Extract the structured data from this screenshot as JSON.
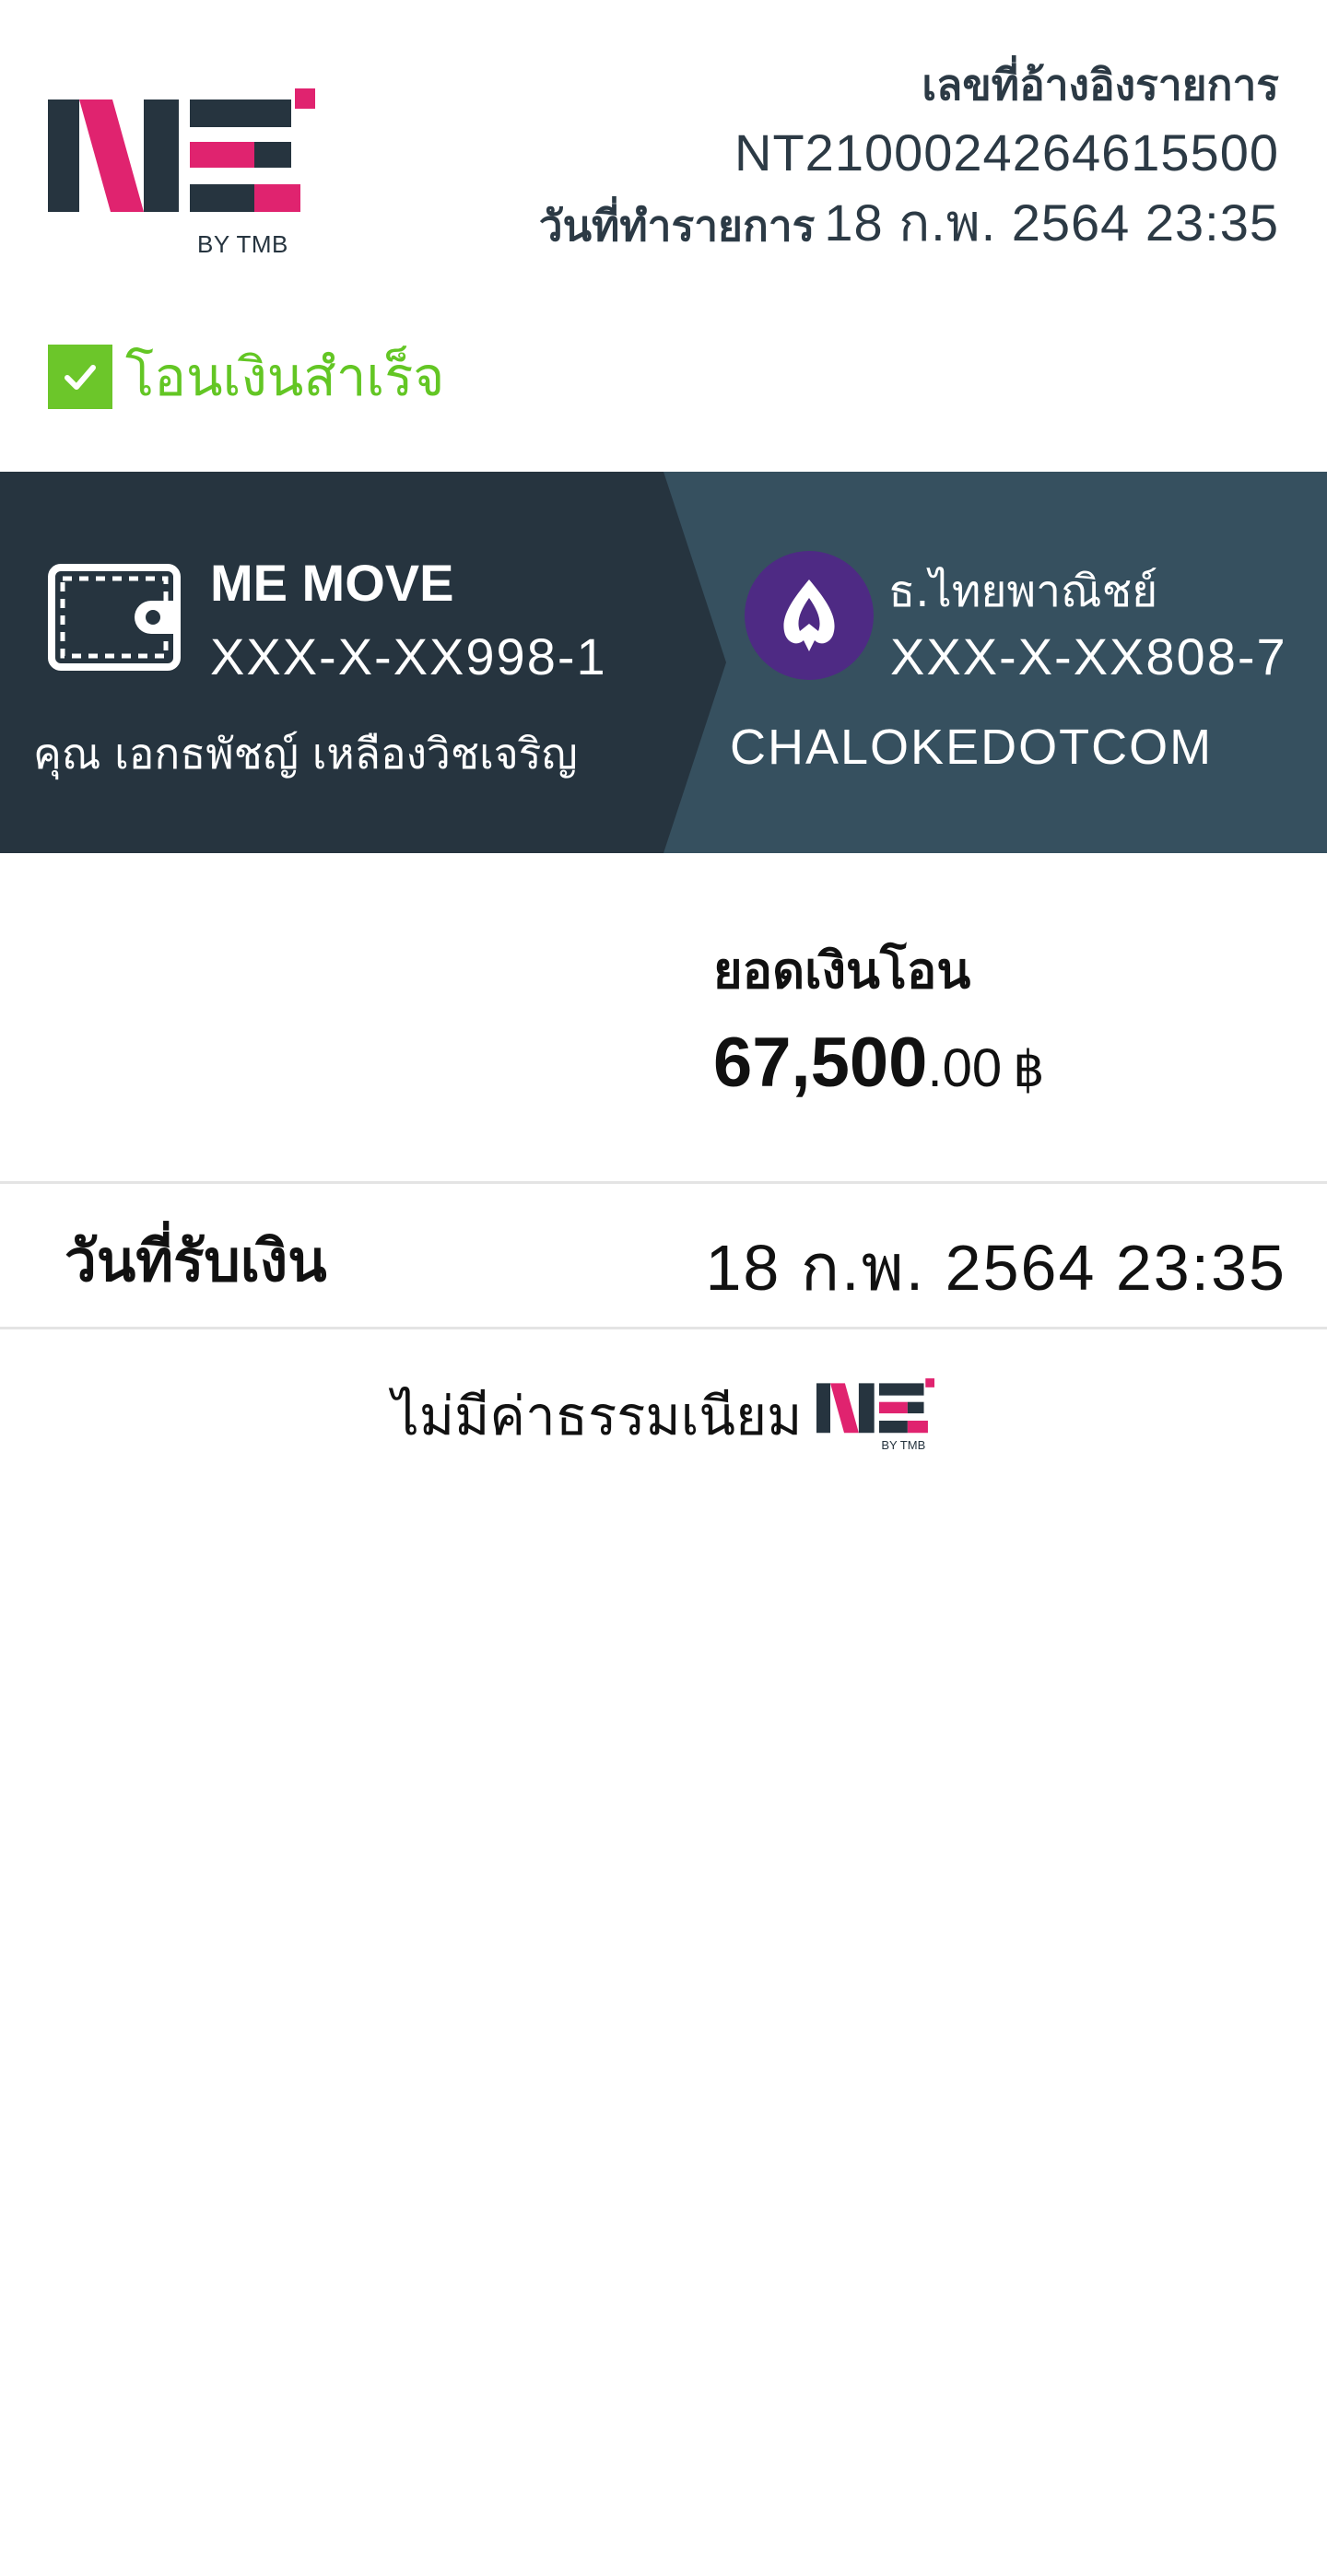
{
  "header": {
    "logo_text": "BY TMB",
    "reference_label": "เลขที่อ้างอิงรายการ",
    "reference_number": "NT2100024264615500",
    "transaction_date_label": "วันที่ทำรายการ",
    "transaction_date_value": "18 ก.พ. 2564 23:35"
  },
  "status": {
    "icon": "check-icon",
    "text": "โอนเงินสำเร็จ",
    "color": "#63c624"
  },
  "transfer": {
    "from": {
      "icon": "wallet-icon",
      "name": "ME MOVE",
      "account": "XXX-X-XX998-1",
      "owner": "คุณ เอกธพัชญ์ เหลืองวิชเจริญ"
    },
    "to": {
      "icon": "scb-bank-icon",
      "bank": "ธ.ไทยพาณิชย์",
      "account": "XXX-X-XX808-7",
      "name": "CHALOKEDOTCOM"
    },
    "colors": {
      "left": "#26343f",
      "right": "#36505f",
      "bank_logo": "#4e2a84"
    }
  },
  "amount": {
    "label": "ยอดเงินโอน",
    "integer": "67,500",
    "decimal": ".00",
    "currency": "฿"
  },
  "receive": {
    "label": "วันที่รับเงิน",
    "value": "18 ก.พ. 2564 23:35"
  },
  "fee": {
    "text": "ไม่มีค่าธรรมเนียม",
    "logo_text": "BY TMB"
  },
  "brand_colors": {
    "dark": "#26343f",
    "pink": "#e0236f"
  }
}
